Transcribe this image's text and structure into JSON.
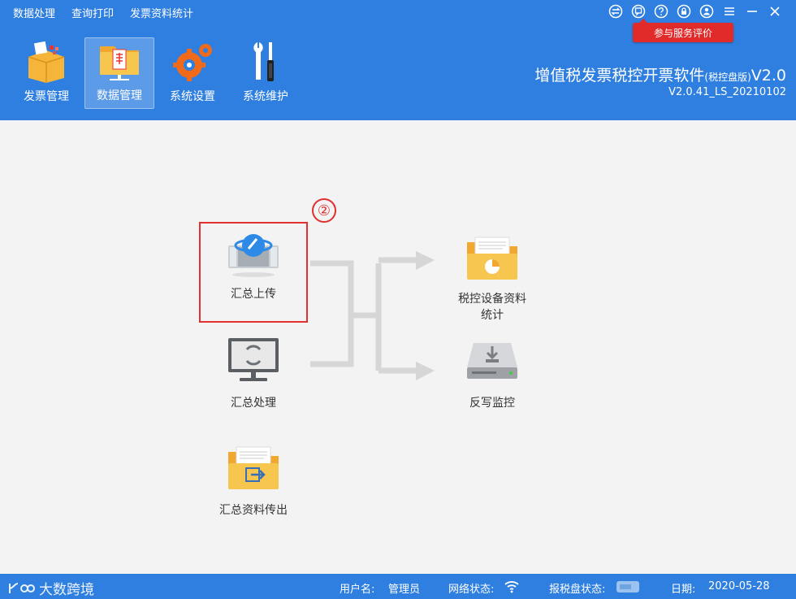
{
  "menu": [
    "数据处理",
    "查询打印",
    "发票资料统计"
  ],
  "eval_button": "参与服务评价",
  "toolbar": [
    {
      "label": "发票管理",
      "icon": "box-icon",
      "active": false
    },
    {
      "label": "数据管理",
      "icon": "folder-icon",
      "active": true
    },
    {
      "label": "系统设置",
      "icon": "gears-icon",
      "active": false
    },
    {
      "label": "系统维护",
      "icon": "tools-icon",
      "active": false
    }
  ],
  "app": {
    "title": "增值税发票税控开票软件",
    "title_suffix": "(税控盘版)",
    "title_ver": "V2.0",
    "version": "V2.0.41_LS_20210102"
  },
  "main": {
    "step_marker": "②",
    "items": {
      "summary_upload": "汇总上传",
      "summary_process": "汇总处理",
      "summary_export": "汇总资料传出",
      "device_stats_1": "税控设备资料",
      "device_stats_2": "统计",
      "writeback": "反写监控"
    }
  },
  "status": {
    "logo": "大数跨境",
    "user_label": "用户名:",
    "user_value": "管理员",
    "net_label": "网络状态:",
    "disk_label": "报税盘状态:",
    "date_label": "日期:",
    "date_value": "2020-05-28"
  },
  "colors": {
    "brand": "#2f7fe0",
    "accent": "#e12a2a"
  }
}
